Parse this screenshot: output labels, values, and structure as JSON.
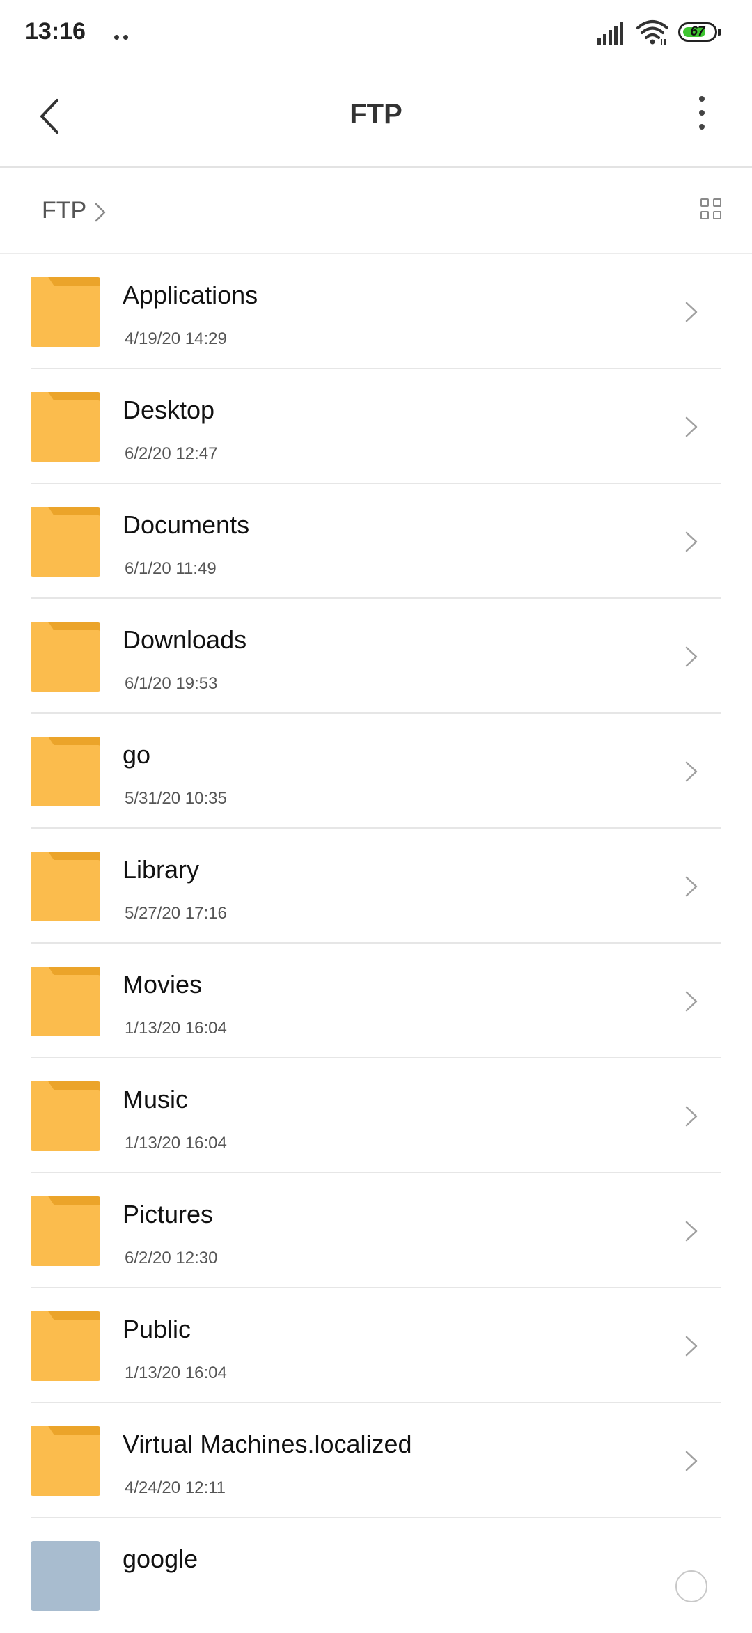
{
  "status_bar": {
    "time": "13:16",
    "battery_level": "67",
    "battery_fraction": 0.67,
    "icons": [
      "signal-icon",
      "wifi-icon",
      "battery-icon"
    ]
  },
  "header": {
    "title": "FTP",
    "back_icon": "chevron-left-icon",
    "more_icon": "more-vertical-icon"
  },
  "breadcrumb": {
    "items": [
      "FTP"
    ],
    "view_toggle_icon": "grid-view-icon"
  },
  "files": [
    {
      "name": "Applications",
      "date": "4/19/20 14:29",
      "type": "folder"
    },
    {
      "name": "Desktop",
      "date": "6/2/20 12:47",
      "type": "folder"
    },
    {
      "name": "Documents",
      "date": "6/1/20 11:49",
      "type": "folder"
    },
    {
      "name": "Downloads",
      "date": "6/1/20 19:53",
      "type": "folder"
    },
    {
      "name": "go",
      "date": "5/31/20 10:35",
      "type": "folder"
    },
    {
      "name": "Library",
      "date": "5/27/20 17:16",
      "type": "folder"
    },
    {
      "name": "Movies",
      "date": "1/13/20 16:04",
      "type": "folder"
    },
    {
      "name": "Music",
      "date": "1/13/20 16:04",
      "type": "folder"
    },
    {
      "name": "Pictures",
      "date": "6/2/20 12:30",
      "type": "folder"
    },
    {
      "name": "Public",
      "date": "1/13/20 16:04",
      "type": "folder"
    },
    {
      "name": "Virtual Machines.localized",
      "date": "4/24/20 12:11",
      "type": "folder"
    },
    {
      "name": "google",
      "date": "",
      "type": "file"
    }
  ],
  "colors": {
    "folder_body": "#fbbc4d",
    "folder_tab": "#eba42a",
    "battery_fill": "#3ec531",
    "file_icon": "#a8bccf"
  }
}
